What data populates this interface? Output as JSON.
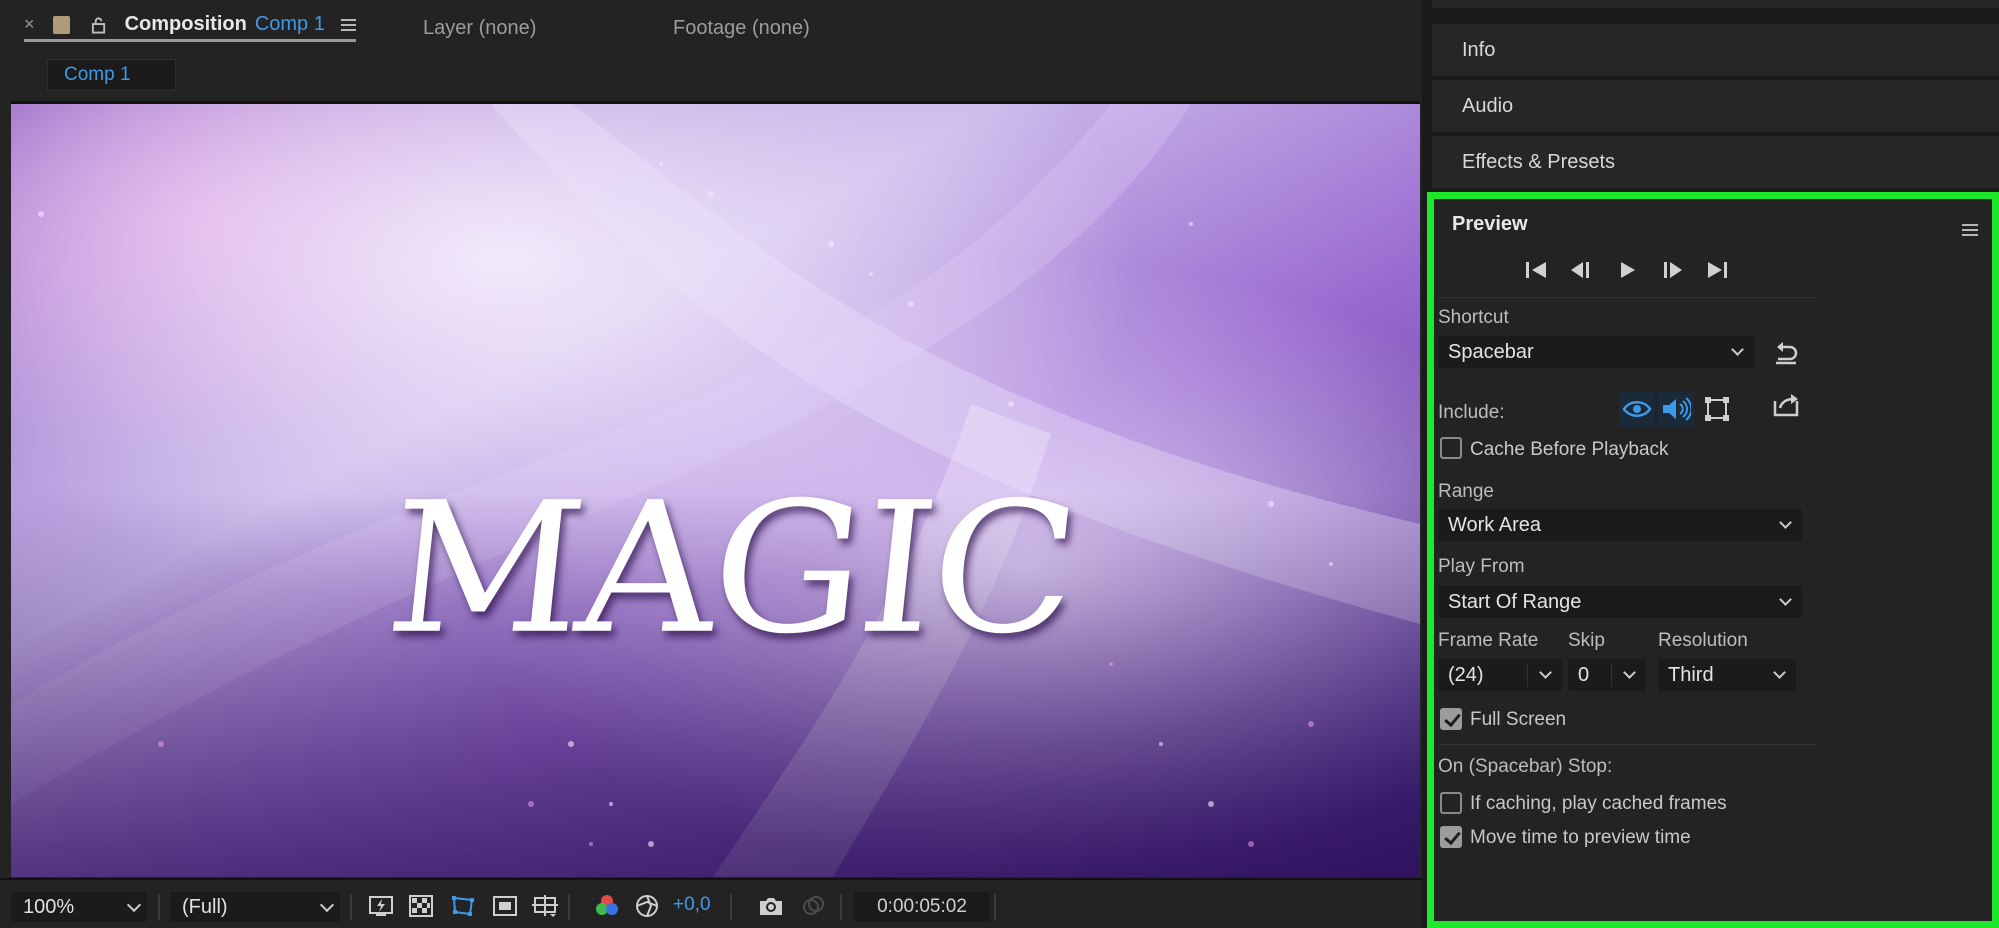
{
  "composition_panel": {
    "tabs": {
      "close_glyph": "×",
      "composition_label": "Composition",
      "comp_name": "Comp 1",
      "layer": "Layer (none)",
      "footage": "Footage (none)"
    },
    "subtab": "Comp 1",
    "viewer_text": "MAGIC",
    "footer": {
      "zoom": "100%",
      "resolution": "(Full)",
      "exposure": "+0,0",
      "timecode": "0:00:05:02"
    }
  },
  "right_panels": {
    "info": "Info",
    "audio": "Audio",
    "effects_presets": "Effects & Presets"
  },
  "preview": {
    "title": "Preview",
    "transport_icons": [
      "first-frame-icon",
      "previous-frame-icon",
      "play-icon",
      "next-frame-icon",
      "last-frame-icon"
    ],
    "shortcut_label": "Shortcut",
    "shortcut_value": "Spacebar",
    "include_label": "Include:",
    "cache_before_playback": {
      "label": "Cache Before Playback",
      "checked": false
    },
    "range_label": "Range",
    "range_value": "Work Area",
    "play_from_label": "Play From",
    "play_from_value": "Start Of Range",
    "frame_rate_label": "Frame Rate",
    "frame_rate_value": "(24)",
    "skip_label": "Skip",
    "skip_value": "0",
    "resolution_label": "Resolution",
    "resolution_value": "Third",
    "full_screen": {
      "label": "Full Screen",
      "checked": true
    },
    "on_stop_label": "On (Spacebar) Stop:",
    "if_caching": {
      "label": "If caching, play cached frames",
      "checked": false
    },
    "move_time": {
      "label": "Move time to preview time",
      "checked": true
    }
  },
  "colors": {
    "accent_blue": "#3f9ae6",
    "highlight_green": "#1ee82a",
    "panel_bg": "#232323"
  }
}
